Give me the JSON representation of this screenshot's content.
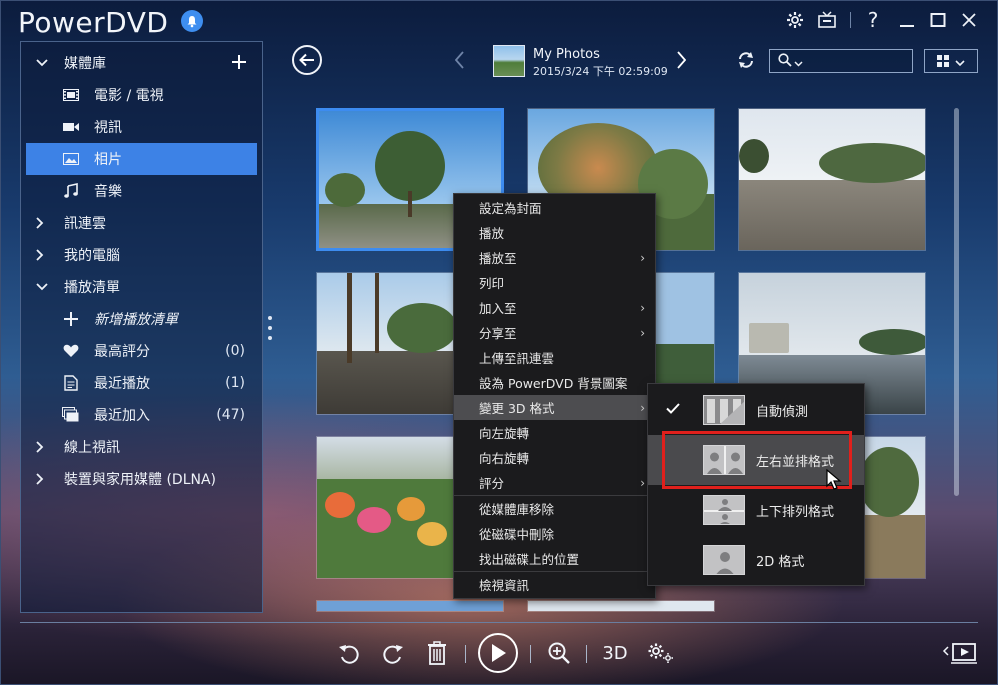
{
  "app": {
    "title": "PowerDVD"
  },
  "window_controls": [
    "gear-icon",
    "tv-icon",
    "help-icon",
    "minimize-icon",
    "maximize-icon",
    "close-icon"
  ],
  "help_label": "?",
  "sidebar": {
    "library": {
      "label": "媒體庫",
      "children": [
        "電影 / 電視",
        "視訊",
        "相片",
        "音樂"
      ],
      "active": "相片"
    },
    "cloud": "訊連雲",
    "my_computer": "我的電腦",
    "playlist": {
      "label": "播放清單",
      "new": "新增播放清單",
      "top_rated": {
        "label": "最高評分",
        "count": "(0)"
      },
      "recent_played": {
        "label": "最近播放",
        "count": "(1)"
      },
      "recent_added": {
        "label": "最近加入",
        "count": "(47)"
      }
    },
    "online_video": "線上視訊",
    "dlna": "裝置與家用媒體 (DLNA)"
  },
  "album": {
    "title": "My Photos",
    "date": "2015/3/24 下午 02:59:09"
  },
  "search": {
    "placeholder": ""
  },
  "context_menu": {
    "items": [
      "設定為封面",
      "播放",
      "播放至",
      "列印",
      "加入至",
      "分享至",
      "上傳至訊連雲",
      "設為 PowerDVD 背景圖案",
      "變更 3D 格式",
      "向左旋轉",
      "向右旋轉",
      "評分",
      "從媒體庫移除",
      "從磁碟中刪除",
      "找出磁碟上的位置",
      "檢視資訊"
    ],
    "has_submenu": [
      "播放至",
      "加入至",
      "分享至",
      "變更 3D 格式",
      "評分"
    ],
    "hovered": "變更 3D 格式"
  },
  "submenu_3d": {
    "items": [
      "自動偵測",
      "左右並排格式",
      "上下排列格式",
      "2D 格式"
    ],
    "checked": "自動偵測",
    "hovered": "左右並排格式"
  },
  "toolbar": {
    "three_d_label": "3D"
  },
  "colors": {
    "accent": "#3d82e6",
    "selection_border": "#3d8cf0",
    "annotation": "#e0201c"
  }
}
